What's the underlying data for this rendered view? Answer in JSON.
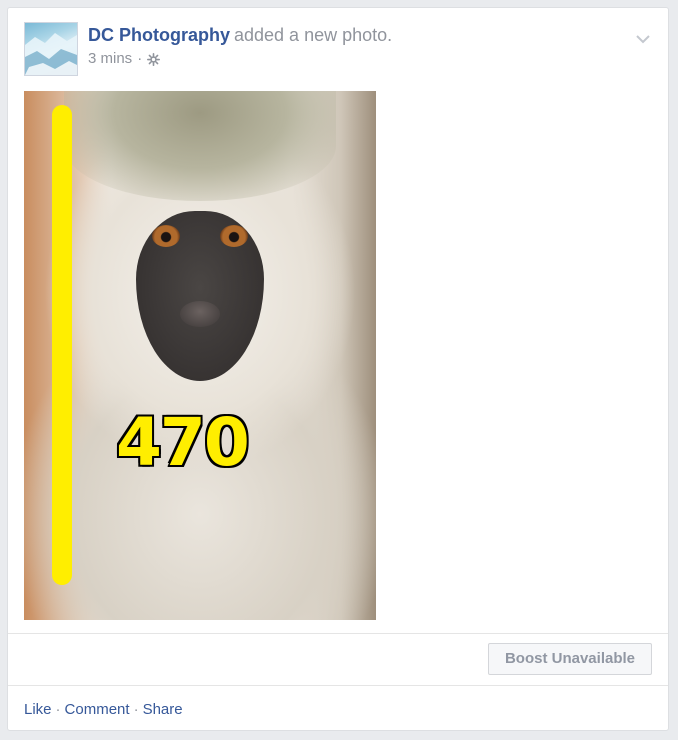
{
  "post": {
    "page_name": "DC Photography",
    "action": "added a new photo.",
    "timestamp": "3 mins",
    "privacy_icon": "gear-icon",
    "menu_icon": "chevron-down-icon"
  },
  "photo": {
    "subject": "monkey",
    "overlay_number": "470",
    "overlay_color": "#ffee00"
  },
  "boost": {
    "label": "Boost Unavailable"
  },
  "actions": {
    "like": "Like",
    "comment": "Comment",
    "share": "Share",
    "separator": "·"
  },
  "colors": {
    "link": "#365899",
    "muted": "#90949c",
    "card_bg": "#ffffff",
    "page_bg": "#e9ebee"
  }
}
